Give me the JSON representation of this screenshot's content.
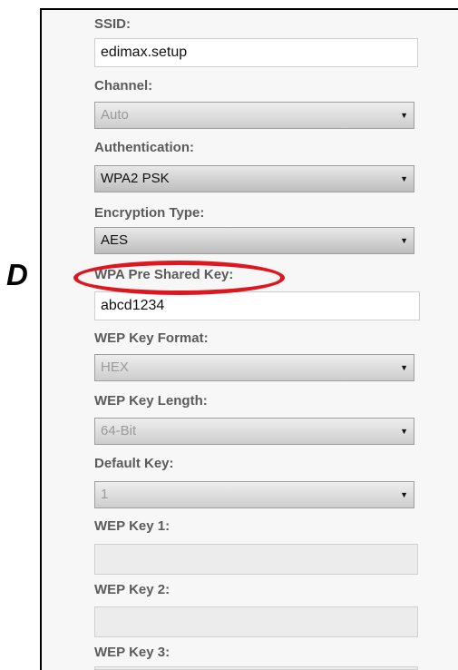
{
  "side_label": "D",
  "form": {
    "ssid": {
      "label": "SSID:",
      "value": "edimax.setup"
    },
    "channel": {
      "label": "Channel:",
      "value": "Auto"
    },
    "authentication": {
      "label": "Authentication:",
      "value": "WPA2 PSK"
    },
    "encryption_type": {
      "label": "Encryption Type:",
      "value": "AES"
    },
    "wpa_psk": {
      "label": "WPA Pre Shared Key:",
      "value": "abcd1234"
    },
    "wep_key_format": {
      "label": "WEP Key Format:",
      "value": "HEX"
    },
    "wep_key_length": {
      "label": "WEP Key Length:",
      "value": "64-Bit"
    },
    "default_key": {
      "label": "Default Key:",
      "value": "1"
    },
    "wep_key_1": {
      "label": "WEP Key 1:",
      "value": ""
    },
    "wep_key_2": {
      "label": "WEP Key 2:",
      "value": ""
    },
    "wep_key_3": {
      "label": "WEP Key 3:",
      "value": ""
    }
  },
  "colors": {
    "highlight": "#e0161e",
    "label": "#5b5b5b"
  },
  "icons": {
    "dropdown": "dropdown-arrow-icon"
  }
}
